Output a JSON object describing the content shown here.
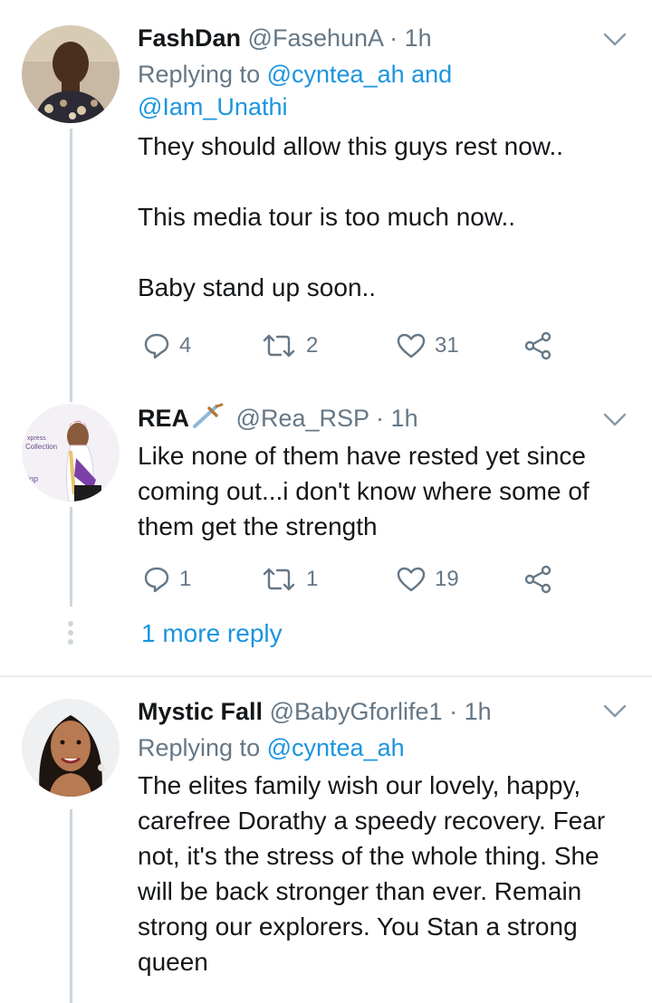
{
  "tweets": [
    {
      "name": "FashDan",
      "handle": "@FasehunA",
      "dot": "·",
      "time": "1h",
      "replying_prefix": "Replying to",
      "replying_to_1": "@cyntea_ah",
      "replying_and": "and",
      "replying_to_2": "@Iam_Unathi",
      "text": "They should allow this guys rest now..\n\nThis media tour is too much now..\n\nBaby stand up soon..",
      "replies": "4",
      "retweets": "2",
      "likes": "31"
    },
    {
      "name": "REA",
      "handle": "@Rea_RSP",
      "dot": "·",
      "time": "1h",
      "text": "Like none of them have rested yet since coming out...i don't know where some of them get the strength",
      "replies": "1",
      "retweets": "1",
      "likes": "19",
      "more_replies": "1 more reply"
    },
    {
      "name": "Mystic Fall",
      "handle": "@BabyGforlife1",
      "dot": "·",
      "time": "1h",
      "replying_prefix": "Replying to",
      "replying_to_1": "@cyntea_ah",
      "text": "The elites family wish our lovely, happy, carefree Dorathy a speedy recovery. Fear not, it's the stress of the whole thing. She will be back stronger than ever. Remain strong our explorers. You Stan a strong queen"
    }
  ],
  "colors": {
    "text": "#14171a",
    "secondary": "#657786",
    "link": "#1b95e0",
    "thread_line": "#ccd6dd",
    "divider": "#e6ecf0"
  },
  "icons": [
    "reply-icon",
    "retweet-icon",
    "like-icon",
    "share-icon",
    "chevron-down-icon",
    "sword-emoji-icon"
  ]
}
